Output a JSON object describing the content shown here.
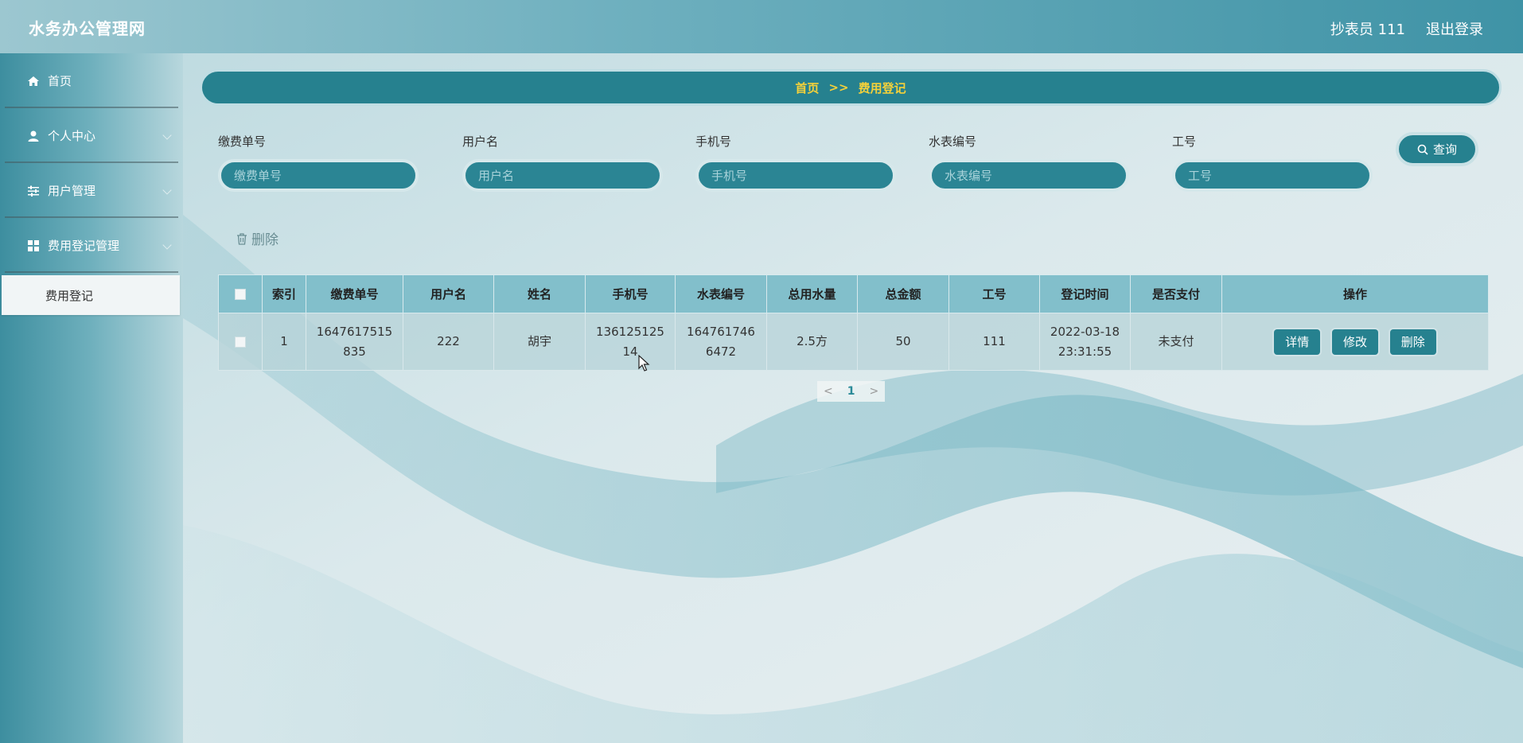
{
  "header": {
    "title": "水务办公管理网",
    "user_label": "抄表员 111",
    "logout_label": "退出登录"
  },
  "sidebar": {
    "items": [
      {
        "label": "首页",
        "icon": "home-icon"
      },
      {
        "label": "个人中心",
        "icon": "person-icon"
      },
      {
        "label": "用户管理",
        "icon": "sliders-icon"
      },
      {
        "label": "费用登记管理",
        "icon": "grid-icon"
      }
    ],
    "sub_item": "费用登记"
  },
  "breadcrumb": {
    "home": "首页",
    "separator": ">>",
    "current": "费用登记"
  },
  "search": {
    "fields": [
      {
        "label": "缴费单号",
        "placeholder": "缴费单号"
      },
      {
        "label": "用户名",
        "placeholder": "用户名"
      },
      {
        "label": "手机号",
        "placeholder": "手机号"
      },
      {
        "label": "水表编号",
        "placeholder": "水表编号"
      },
      {
        "label": "工号",
        "placeholder": "工号"
      }
    ],
    "query_label": "查询"
  },
  "toolbar": {
    "delete_label": "删除"
  },
  "table": {
    "columns": [
      "索引",
      "缴费单号",
      "用户名",
      "姓名",
      "手机号",
      "水表编号",
      "总用水量",
      "总金额",
      "工号",
      "登记时间",
      "是否支付",
      "操作"
    ],
    "rows": [
      {
        "index": "1",
        "bill_no": "1647617515835",
        "username": "222",
        "name": "胡宇",
        "phone": "13612512514",
        "meter_no": "1647617466472",
        "water": "2.5方",
        "amount": "50",
        "job_no": "111",
        "time": "2022-03-18 23:31:55",
        "paid": "未支付",
        "actions": {
          "detail": "详情",
          "edit": "修改",
          "delete": "删除"
        }
      }
    ]
  },
  "pagination": {
    "current": "1",
    "prev": "<",
    "next": ">"
  },
  "colors": {
    "primary": "#26818f",
    "breadcrumb_text": "#f4d13a",
    "header_start": "#9cc7d0",
    "header_end": "#3f93a6"
  }
}
